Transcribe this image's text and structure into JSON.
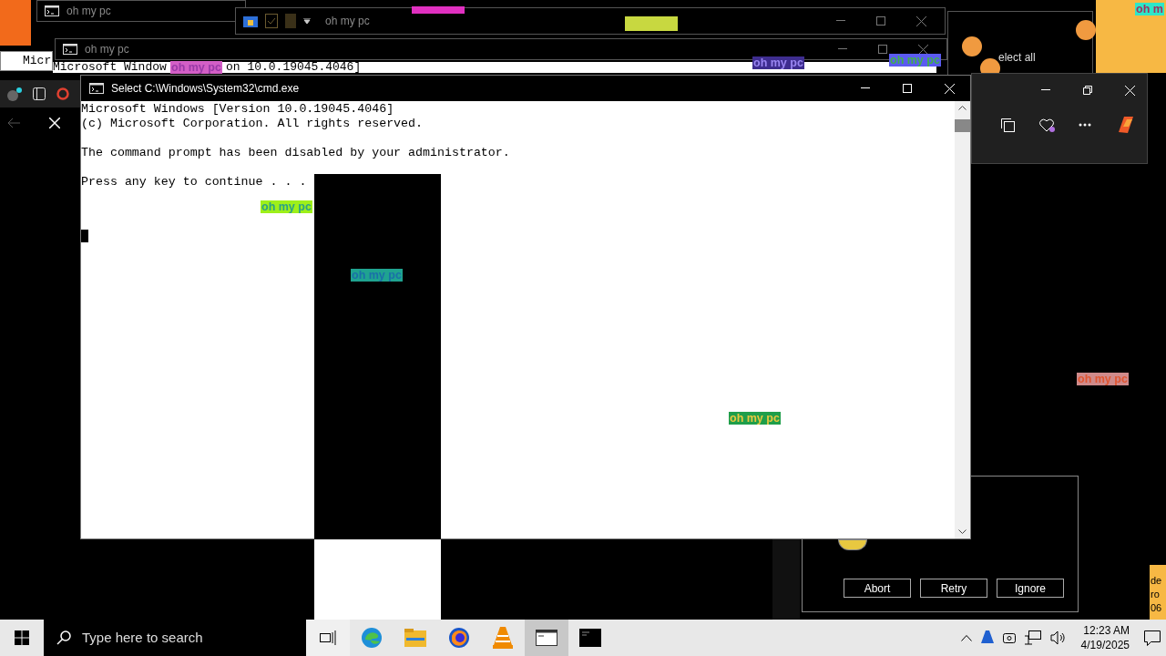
{
  "background_windows": [
    {
      "title": "oh my pc"
    },
    {
      "title": "oh my pc"
    }
  ],
  "explorer_window": {
    "title": "oh my pc"
  },
  "partial_console": {
    "left_text": "Micr",
    "line_start": "Microsoft Window",
    "line_end": "on 10.0.19045.4046]"
  },
  "select_all_text": "elect all",
  "console": {
    "title": "Select C:\\Windows\\System32\\cmd.exe",
    "lines": [
      "Microsoft Windows [Version 10.0.19045.4046]",
      "(c) Microsoft Corporation. All rights reserved.",
      "The command prompt has been disabled by your administrator.",
      "Press any key to continue . . ."
    ]
  },
  "floating_labels": [
    {
      "text": "oh my pc",
      "color": "#d35fc6"
    },
    {
      "text": "oh my pc",
      "color": "#3e2d8f"
    },
    {
      "text": "oh my pc",
      "color": "#5b5bf0"
    },
    {
      "text": "oh m",
      "color": "#2ee6c8"
    },
    {
      "text": "oh my pc",
      "color": "#9ef01a"
    },
    {
      "text": "oh my pc",
      "color": "#1fa390"
    },
    {
      "text": "oh my pc",
      "color": "#cf8a8a"
    },
    {
      "text": "oh my pc",
      "color": "#1f9e4a"
    }
  ],
  "dialog": {
    "buttons": [
      "Abort",
      "Retry",
      "Ignore"
    ]
  },
  "edge_texts": [
    "de",
    "ro",
    "06"
  ],
  "taskbar": {
    "search_placeholder": "Type here to search",
    "time": "12:23 AM",
    "date": "4/19/2025",
    "apps": [
      {
        "kind": "taskview",
        "selected": false
      },
      {
        "kind": "edge",
        "selected": false
      },
      {
        "kind": "explorer",
        "selected": false
      },
      {
        "kind": "firefox",
        "selected": false
      },
      {
        "kind": "vlc",
        "selected": false
      },
      {
        "kind": "cmd",
        "selected": true
      },
      {
        "kind": "terminal",
        "selected": false
      }
    ]
  }
}
